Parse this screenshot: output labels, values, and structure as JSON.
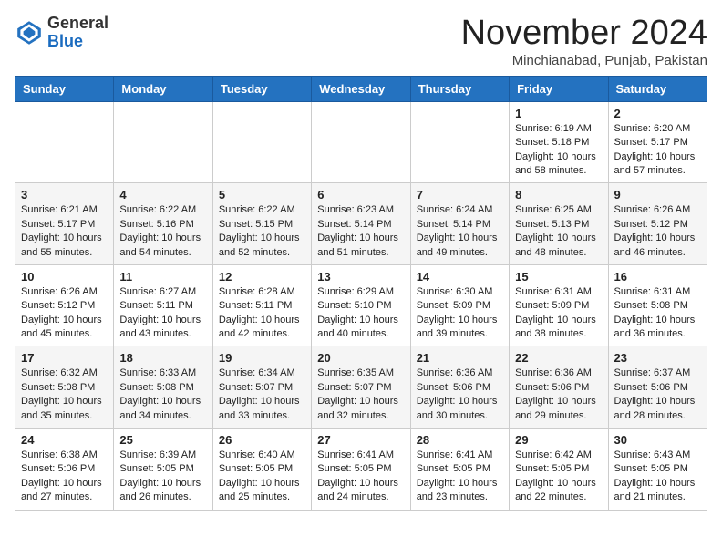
{
  "header": {
    "logo_general": "General",
    "logo_blue": "Blue",
    "month_title": "November 2024",
    "location": "Minchianabad, Punjab, Pakistan"
  },
  "weekdays": [
    "Sunday",
    "Monday",
    "Tuesday",
    "Wednesday",
    "Thursday",
    "Friday",
    "Saturday"
  ],
  "weeks": [
    [
      {
        "day": "",
        "info": ""
      },
      {
        "day": "",
        "info": ""
      },
      {
        "day": "",
        "info": ""
      },
      {
        "day": "",
        "info": ""
      },
      {
        "day": "",
        "info": ""
      },
      {
        "day": "1",
        "info": "Sunrise: 6:19 AM\nSunset: 5:18 PM\nDaylight: 10 hours and 58 minutes."
      },
      {
        "day": "2",
        "info": "Sunrise: 6:20 AM\nSunset: 5:17 PM\nDaylight: 10 hours and 57 minutes."
      }
    ],
    [
      {
        "day": "3",
        "info": "Sunrise: 6:21 AM\nSunset: 5:17 PM\nDaylight: 10 hours and 55 minutes."
      },
      {
        "day": "4",
        "info": "Sunrise: 6:22 AM\nSunset: 5:16 PM\nDaylight: 10 hours and 54 minutes."
      },
      {
        "day": "5",
        "info": "Sunrise: 6:22 AM\nSunset: 5:15 PM\nDaylight: 10 hours and 52 minutes."
      },
      {
        "day": "6",
        "info": "Sunrise: 6:23 AM\nSunset: 5:14 PM\nDaylight: 10 hours and 51 minutes."
      },
      {
        "day": "7",
        "info": "Sunrise: 6:24 AM\nSunset: 5:14 PM\nDaylight: 10 hours and 49 minutes."
      },
      {
        "day": "8",
        "info": "Sunrise: 6:25 AM\nSunset: 5:13 PM\nDaylight: 10 hours and 48 minutes."
      },
      {
        "day": "9",
        "info": "Sunrise: 6:26 AM\nSunset: 5:12 PM\nDaylight: 10 hours and 46 minutes."
      }
    ],
    [
      {
        "day": "10",
        "info": "Sunrise: 6:26 AM\nSunset: 5:12 PM\nDaylight: 10 hours and 45 minutes."
      },
      {
        "day": "11",
        "info": "Sunrise: 6:27 AM\nSunset: 5:11 PM\nDaylight: 10 hours and 43 minutes."
      },
      {
        "day": "12",
        "info": "Sunrise: 6:28 AM\nSunset: 5:11 PM\nDaylight: 10 hours and 42 minutes."
      },
      {
        "day": "13",
        "info": "Sunrise: 6:29 AM\nSunset: 5:10 PM\nDaylight: 10 hours and 40 minutes."
      },
      {
        "day": "14",
        "info": "Sunrise: 6:30 AM\nSunset: 5:09 PM\nDaylight: 10 hours and 39 minutes."
      },
      {
        "day": "15",
        "info": "Sunrise: 6:31 AM\nSunset: 5:09 PM\nDaylight: 10 hours and 38 minutes."
      },
      {
        "day": "16",
        "info": "Sunrise: 6:31 AM\nSunset: 5:08 PM\nDaylight: 10 hours and 36 minutes."
      }
    ],
    [
      {
        "day": "17",
        "info": "Sunrise: 6:32 AM\nSunset: 5:08 PM\nDaylight: 10 hours and 35 minutes."
      },
      {
        "day": "18",
        "info": "Sunrise: 6:33 AM\nSunset: 5:08 PM\nDaylight: 10 hours and 34 minutes."
      },
      {
        "day": "19",
        "info": "Sunrise: 6:34 AM\nSunset: 5:07 PM\nDaylight: 10 hours and 33 minutes."
      },
      {
        "day": "20",
        "info": "Sunrise: 6:35 AM\nSunset: 5:07 PM\nDaylight: 10 hours and 32 minutes."
      },
      {
        "day": "21",
        "info": "Sunrise: 6:36 AM\nSunset: 5:06 PM\nDaylight: 10 hours and 30 minutes."
      },
      {
        "day": "22",
        "info": "Sunrise: 6:36 AM\nSunset: 5:06 PM\nDaylight: 10 hours and 29 minutes."
      },
      {
        "day": "23",
        "info": "Sunrise: 6:37 AM\nSunset: 5:06 PM\nDaylight: 10 hours and 28 minutes."
      }
    ],
    [
      {
        "day": "24",
        "info": "Sunrise: 6:38 AM\nSunset: 5:06 PM\nDaylight: 10 hours and 27 minutes."
      },
      {
        "day": "25",
        "info": "Sunrise: 6:39 AM\nSunset: 5:05 PM\nDaylight: 10 hours and 26 minutes."
      },
      {
        "day": "26",
        "info": "Sunrise: 6:40 AM\nSunset: 5:05 PM\nDaylight: 10 hours and 25 minutes."
      },
      {
        "day": "27",
        "info": "Sunrise: 6:41 AM\nSunset: 5:05 PM\nDaylight: 10 hours and 24 minutes."
      },
      {
        "day": "28",
        "info": "Sunrise: 6:41 AM\nSunset: 5:05 PM\nDaylight: 10 hours and 23 minutes."
      },
      {
        "day": "29",
        "info": "Sunrise: 6:42 AM\nSunset: 5:05 PM\nDaylight: 10 hours and 22 minutes."
      },
      {
        "day": "30",
        "info": "Sunrise: 6:43 AM\nSunset: 5:05 PM\nDaylight: 10 hours and 21 minutes."
      }
    ]
  ]
}
